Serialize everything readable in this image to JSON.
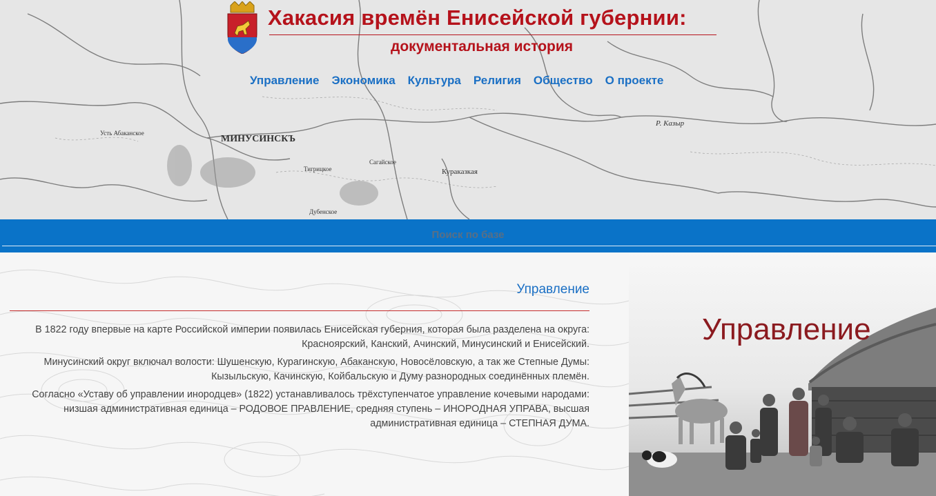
{
  "header": {
    "title": "Хакасия времён Енисейской губернии:",
    "subtitle": "документальная история",
    "map_labels": [
      "МИНУСИНСКЪ",
      "Усть Абаканское",
      "Тигрицкое",
      "Дубенское",
      "Сагайское",
      "Кураказкая",
      "Р. Казыр"
    ]
  },
  "nav": {
    "items": [
      {
        "label": "Управление"
      },
      {
        "label": "Экономика"
      },
      {
        "label": "Культура"
      },
      {
        "label": "Религия"
      },
      {
        "label": "Общество"
      },
      {
        "label": "О проекте"
      }
    ]
  },
  "search": {
    "label": "Поиск по базе"
  },
  "section": {
    "title": "Управление",
    "paragraphs": [
      "В 1822 году впервые на карте Российской империи появилась Енисейская губерния, которая была разделена на округа: Красноярский, Канский, Ачинский, Минусинский и Енисейский.",
      "Минусинский округ включал волости: Шушенскую, Курагинскую, Абаканскую, Новосёловскую, а так же Степные Думы: Кызыльскую, Качинскую, Койбальскую и Думу разнородных соединённых племён.",
      "Согласно «Уставу об управлении инородцев» (1822) устанавливалось трёхступенчатое управление кочевыми народами: низшая административная единица – РОДОВОЕ ПРАВЛЕНИЕ, средняя ступень – ИНОРОДНАЯ УПРАВА, высшая административная единица – СТЕПНАЯ ДУМА."
    ]
  },
  "photo": {
    "title": "Управление"
  },
  "colors": {
    "title_red": "#b5121b",
    "nav_blue": "#1a6fc4",
    "search_bar": "#0a73c8",
    "photo_title": "#8b1a1f"
  },
  "icons": {
    "logo": "coat-of-arms-icon"
  }
}
